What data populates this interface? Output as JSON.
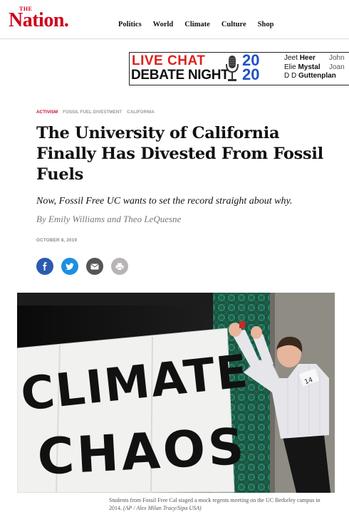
{
  "header": {
    "logo_the": "THE",
    "logo_name": "Nation.",
    "nav": [
      "Politics",
      "World",
      "Climate",
      "Culture",
      "Shop"
    ]
  },
  "ad": {
    "line1": "LIVE CHAT",
    "line2": "DEBATE NIGHT",
    "year_top": "20",
    "year_bottom": "20",
    "speakers": [
      {
        "first": "Jeet",
        "last": "Heer"
      },
      {
        "first": "Elie",
        "last": "Mystal"
      },
      {
        "first": "D D",
        "last": "Guttenplan"
      }
    ],
    "speakers_overflow": [
      "John",
      "Joan"
    ]
  },
  "article": {
    "tags": [
      "Activism",
      "Fossil Fuel Divestment",
      "California"
    ],
    "title": "The University of California Finally Has Divested From Fossil Fuels",
    "subtitle": "Now, Fossil Free UC wants to set the record straight about why.",
    "byline_prefix": "By",
    "author1": "Emily Williams",
    "byline_and": "and",
    "author2": "Theo LeQuesne",
    "date": "October 8, 2019",
    "share": [
      "facebook-icon",
      "twitter-icon",
      "email-icon",
      "print-icon"
    ]
  },
  "photo": {
    "banner_line1": "CLIMATE",
    "banner_line2": "CHAOS",
    "badge": "14",
    "caption": "Students from Fossil Free Cal staged a mock regents meeting on the UC Berkeley campus in 2014.",
    "credit": "(AP / Alex Milan Tracy/Sipa USA)"
  },
  "colors": {
    "brand_red": "#d0021b",
    "tag_red": "#c8102e",
    "facebook": "#2b5bb0",
    "twitter": "#1b8fe0",
    "email": "#555555",
    "print": "#b7b4b4",
    "ad_red": "#e0201b",
    "ad_blue": "#1f52c4"
  }
}
